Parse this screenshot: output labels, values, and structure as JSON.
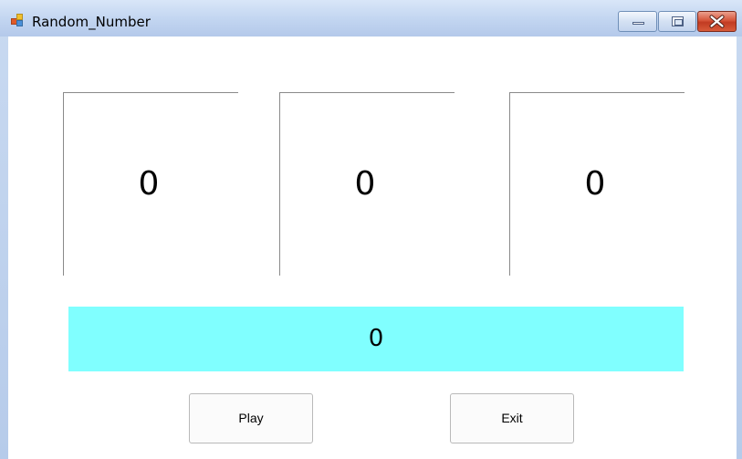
{
  "window": {
    "title": "Random_Number",
    "icon": "winforms-app-icon",
    "controls": [
      "minimize-icon",
      "maximize-icon",
      "close-icon"
    ]
  },
  "slots": {
    "slot1": "0",
    "slot2": "0",
    "slot3": "0"
  },
  "result": {
    "value": "0",
    "background": "#80ffff"
  },
  "buttons": {
    "play_label": "Play",
    "exit_label": "Exit"
  }
}
